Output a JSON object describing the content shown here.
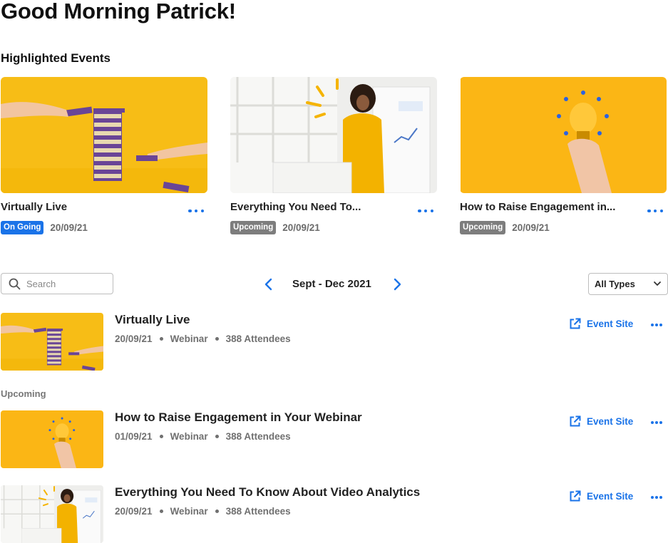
{
  "greeting": "Good Morning Patrick!",
  "highlighted": {
    "title": "Highlighted Events",
    "cards": [
      {
        "title": "Virtually Live",
        "status": "On Going",
        "date": "20/09/21"
      },
      {
        "title": "Everything You Need To...",
        "status": "Upcoming",
        "date": "20/09/21"
      },
      {
        "title": "How to Raise Engagement in...",
        "status": "Upcoming",
        "date": "20/09/21"
      }
    ]
  },
  "toolbar": {
    "search_placeholder": "Search",
    "range_label": "Sept - Dec 2021",
    "type_filter": "All Types"
  },
  "events": [
    {
      "title": "Virtually Live",
      "date": "20/09/21",
      "type": "Webinar",
      "attendees": "388 Attendees",
      "site_label": "Event Site"
    },
    {
      "title": "How to Raise Engagement in Your Webinar",
      "date": "01/09/21",
      "type": "Webinar",
      "attendees": "388 Attendees",
      "site_label": "Event Site"
    },
    {
      "title": "Everything You Need To Know About Video Analytics",
      "date": "20/09/21",
      "type": "Webinar",
      "attendees": "388 Attendees",
      "site_label": "Event Site"
    }
  ],
  "upcoming_label": "Upcoming",
  "colors": {
    "accent": "#1a73e8",
    "thumb_yellow": "#fbb615",
    "badge_grey": "#7d7d7d"
  }
}
